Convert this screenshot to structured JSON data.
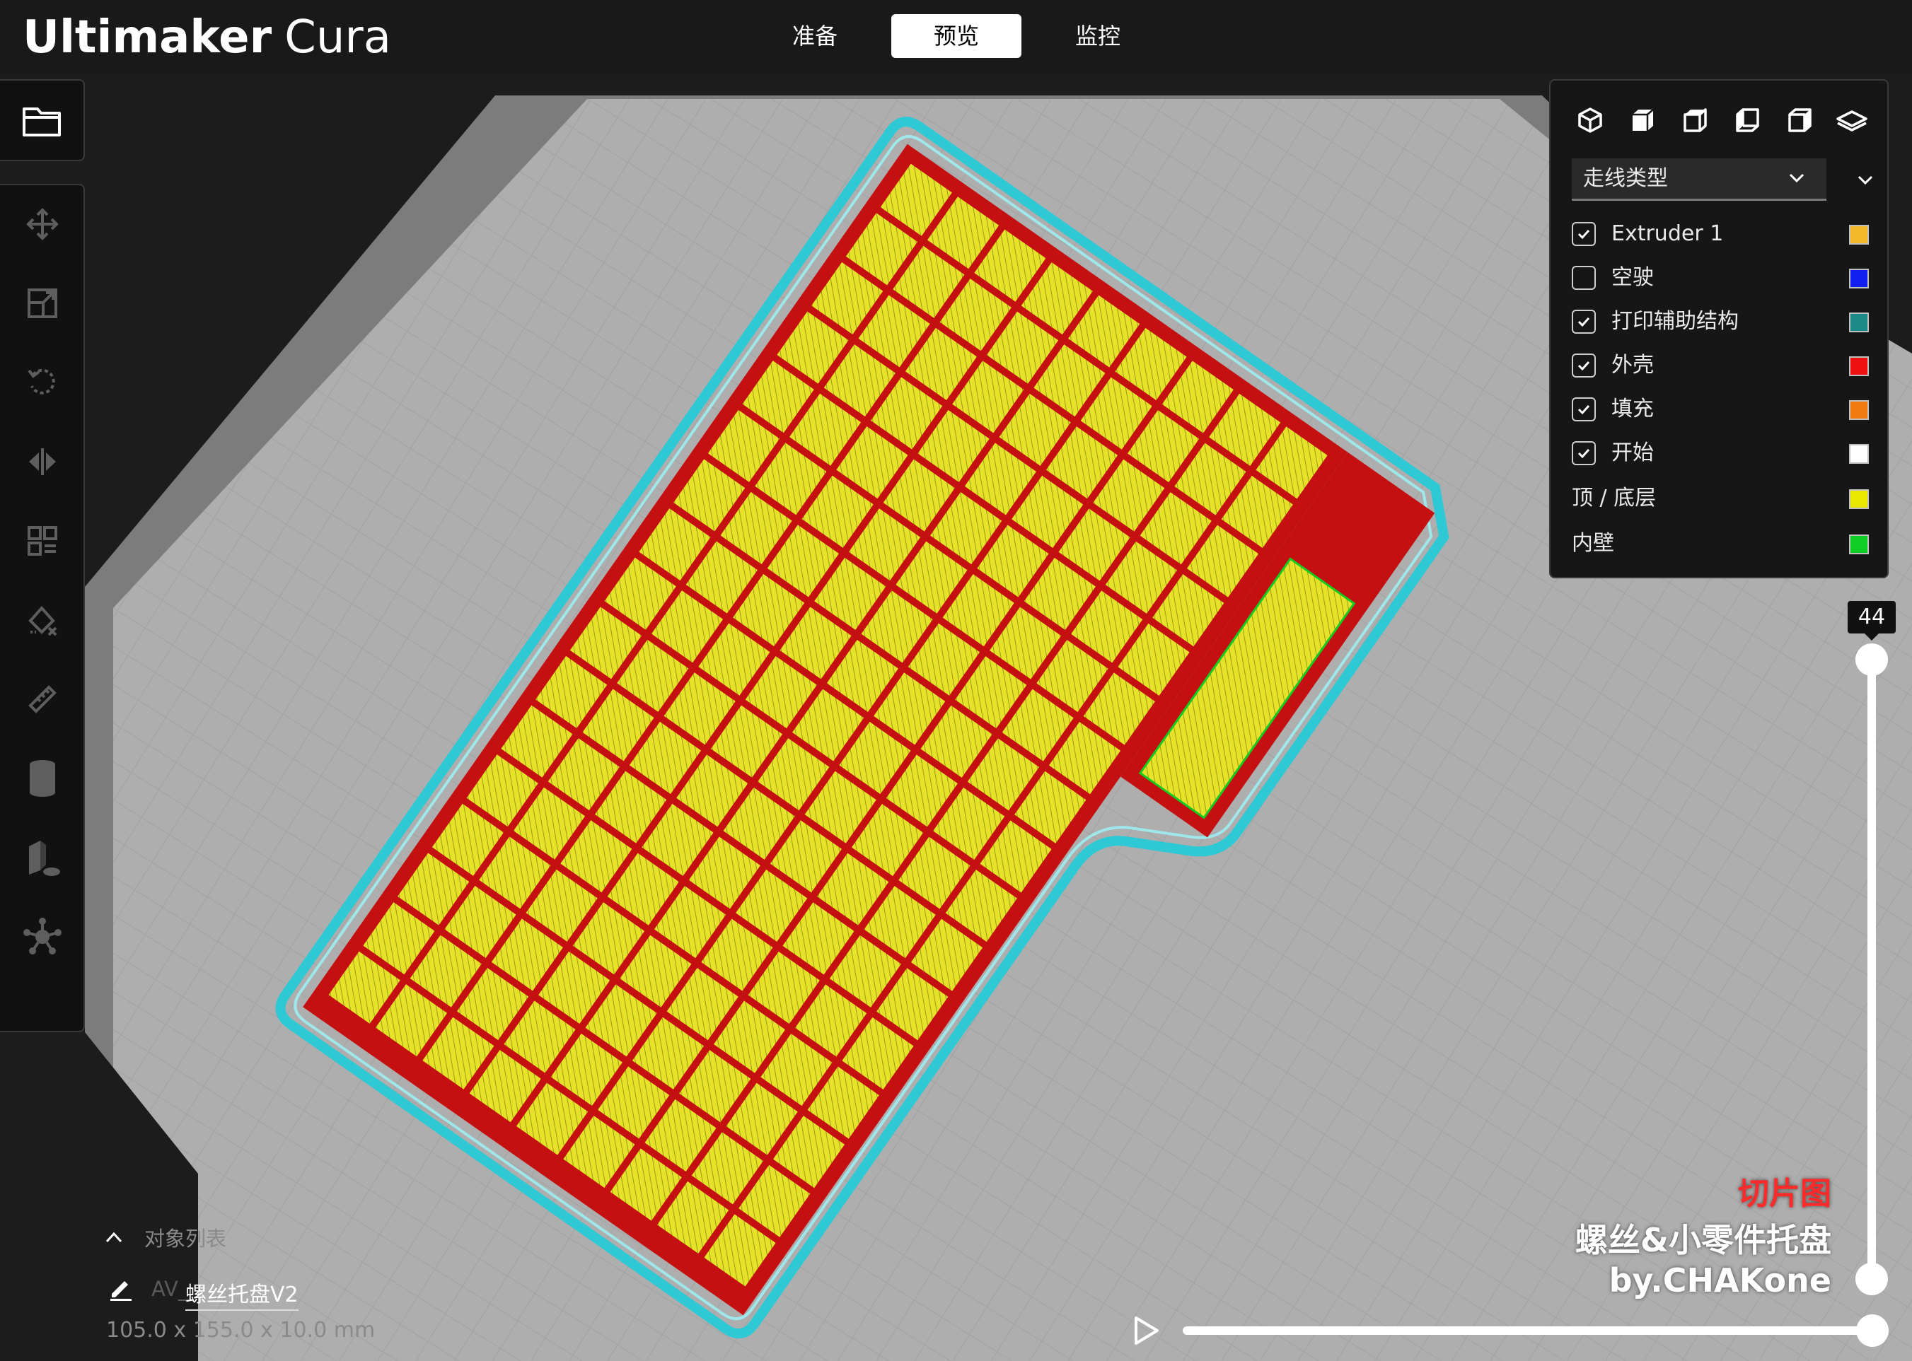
{
  "app": {
    "brand_bold": "Ultimaker",
    "brand_light": "Cura"
  },
  "stages": {
    "tabs": [
      {
        "label": "准备",
        "active": false
      },
      {
        "label": "预览",
        "active": true
      },
      {
        "label": "监控",
        "active": false
      }
    ]
  },
  "toolbar": {
    "open_file_icon": "folder-icon",
    "tools": [
      "move-icon",
      "scale-icon",
      "rotate-icon",
      "mirror-icon",
      "per-model-settings-icon",
      "support-blocker-icon",
      "measure-icon",
      "cylinder-icon",
      "object-custom-icon",
      "star-icon"
    ]
  },
  "view_panel": {
    "camera_icons": [
      "3d-view-icon",
      "front-view-icon",
      "top-view-icon",
      "left-view-icon",
      "right-view-icon",
      "layer-view-icon"
    ],
    "color_scheme": "走线类型",
    "legend": [
      {
        "label": "Extruder 1",
        "checkbox": true,
        "checked": true,
        "color": "#f5b72a"
      },
      {
        "label": "空驶",
        "checkbox": true,
        "checked": false,
        "color": "#1020ee"
      },
      {
        "label": "打印辅助结构",
        "checkbox": true,
        "checked": true,
        "color": "#1c8a86"
      },
      {
        "label": "外壳",
        "checkbox": true,
        "checked": true,
        "color": "#ee1111"
      },
      {
        "label": "填充",
        "checkbox": true,
        "checked": true,
        "color": "#ef7a10"
      },
      {
        "label": "开始",
        "checkbox": true,
        "checked": true,
        "color": "#ffffff"
      },
      {
        "label": "顶 / 底层",
        "checkbox": false,
        "checked": false,
        "color": "#e8e800"
      },
      {
        "label": "内壁",
        "checkbox": false,
        "checked": false,
        "color": "#11cc22"
      }
    ]
  },
  "layer_slider": {
    "current_layer": "44",
    "path_position": 1.0
  },
  "object_list": {
    "toggle_label": "对象列表",
    "name_prefix": "AV_",
    "object_name": "螺丝托盘V2",
    "dimensions": "105.0 x 155.0 x 10.0 mm"
  },
  "overlay": {
    "line1": "切片图",
    "line2": "螺丝&小零件托盘",
    "line3": "by.CHAKone"
  },
  "colors": {
    "header_bg": "#191919",
    "build_plate": "#aeaeae",
    "skirt": "#2ec9d4",
    "shell": "#cc1010",
    "top_bottom": "#e6e22a",
    "accent_white": "#ffffff"
  }
}
